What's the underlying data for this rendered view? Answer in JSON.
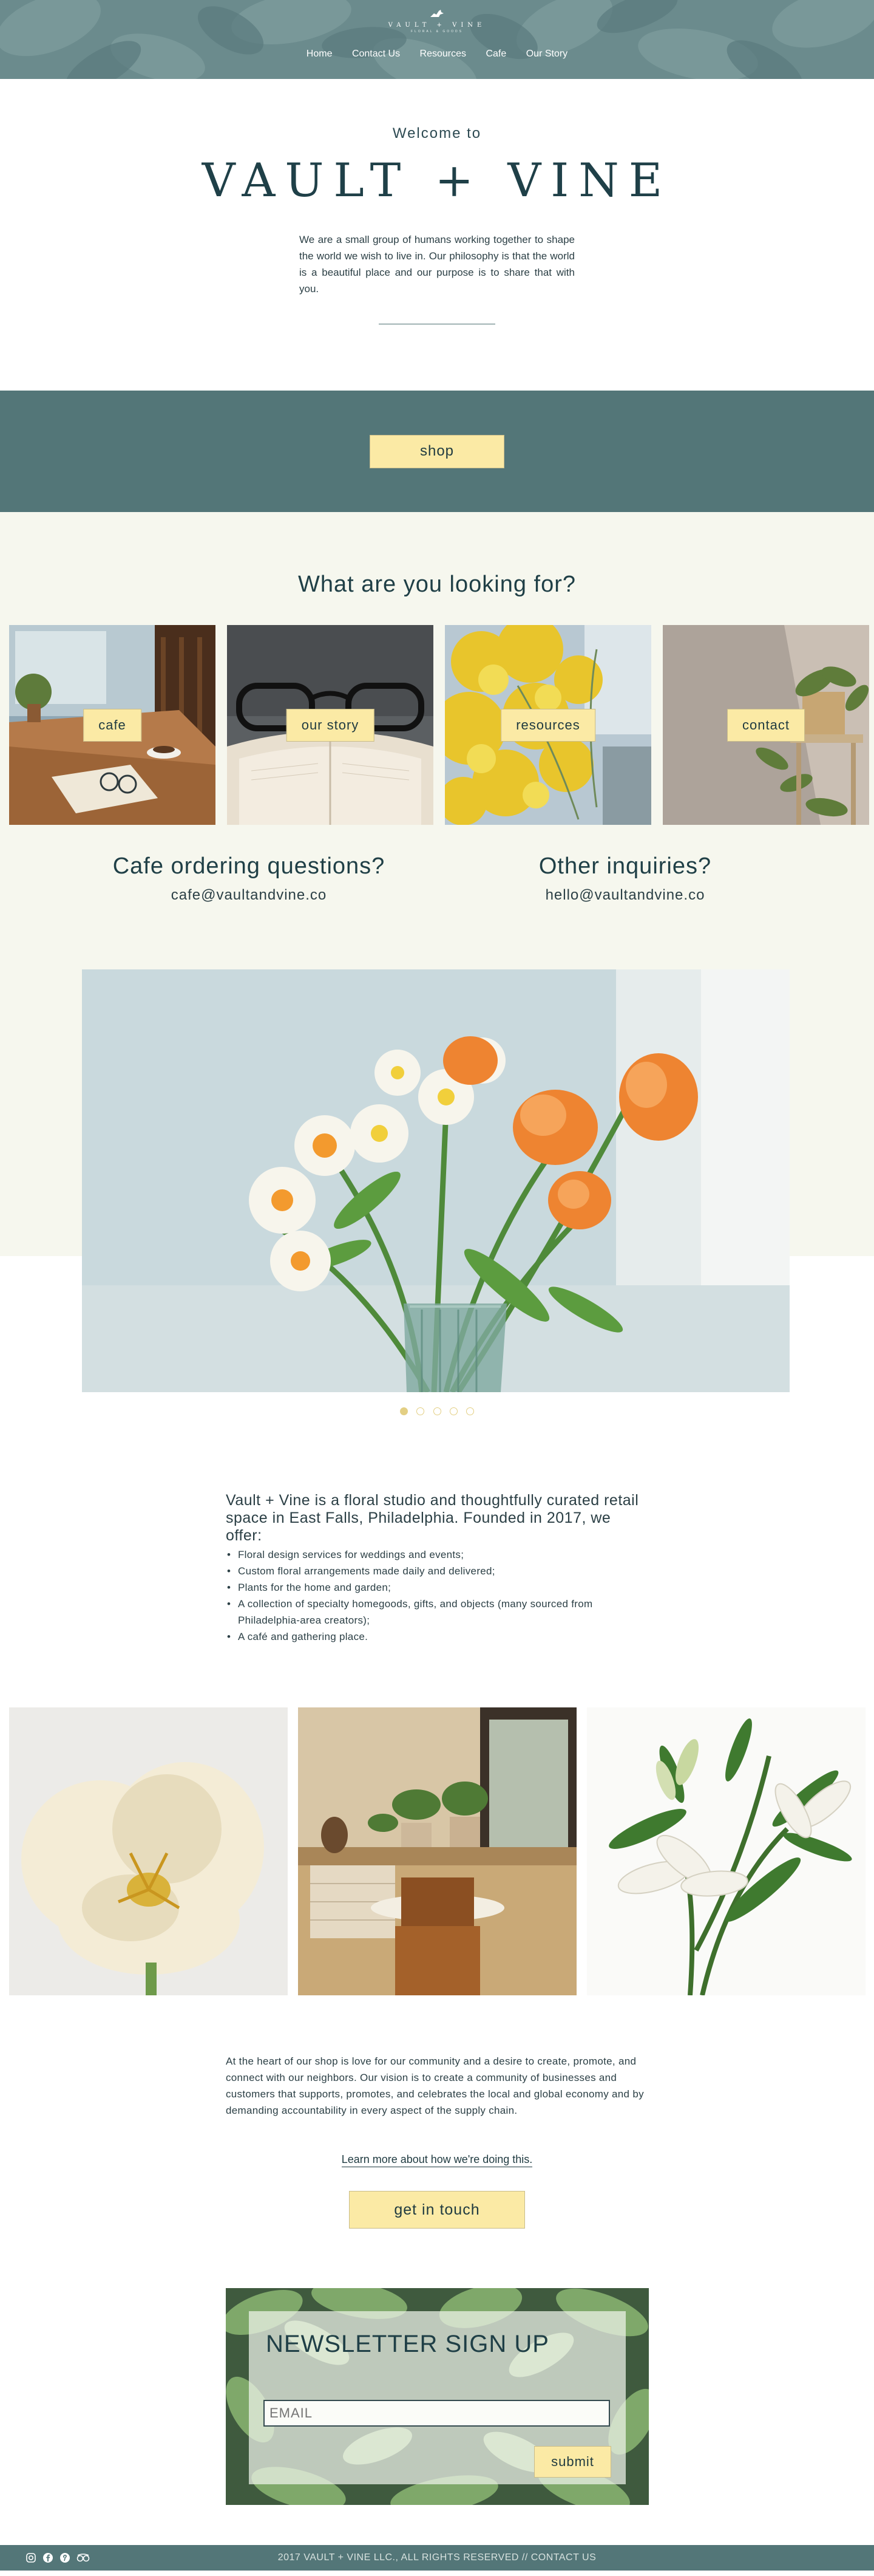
{
  "header": {
    "logo_text": "VAULT + VINE",
    "logo_sub": "FLORAL & GOODS",
    "nav": [
      "Home",
      "Contact Us",
      "Resources",
      "Cafe",
      "Our Story"
    ]
  },
  "welcome": {
    "pre": "Welcome to",
    "title": "VAULT + VINE",
    "intro": "We are a small group of humans working together to shape the world we wish to live in. Our philosophy is that the world is a beautiful place and our purpose is to share that with you."
  },
  "shop": {
    "label": "shop"
  },
  "looking": {
    "heading": "What are you looking for?",
    "tiles": [
      {
        "label": "cafe",
        "icon": "cafe-photo"
      },
      {
        "label": "our story",
        "icon": "book-glasses-photo"
      },
      {
        "label": "resources",
        "icon": "mimosa-photo"
      },
      {
        "label": "contact",
        "icon": "plant-shelf-photo"
      }
    ]
  },
  "inquiries": {
    "cafe_title": "Cafe ordering questions?",
    "cafe_email": "cafe@vaultandvine.co",
    "other_title": "Other inquiries?",
    "other_email": "hello@vaultandvine.co"
  },
  "slideshow": {
    "slide_count": 5,
    "active_index": 0
  },
  "about": {
    "lead": "Vault + Vine is a floral studio and thoughtfully curated retail space in East Falls, Philadelphia. Founded in 2017, we offer:",
    "offers": [
      "Floral design services for weddings and events;",
      "Custom floral arrangements made daily and delivered;",
      "Plants for the home and garden;",
      "A collection of specialty homegoods, gifts, and objects (many sourced from Philadelphia-area creators);",
      "A café and gathering place."
    ]
  },
  "community": {
    "text": "At the heart of our shop is love for our community and a desire to create, promote, and connect with our neighbors. Our vision is to create a community of businesses and customers that supports, promotes, and celebrates the local and global economy and by demanding accountability in every aspect of the supply chain.",
    "learn_more": "Learn more about how we're doing this.",
    "cta": "get in touch"
  },
  "newsletter": {
    "title": "NEWSLETTER SIGN UP",
    "email_placeholder": "EMAIL",
    "submit": "submit"
  },
  "footer": {
    "copyright": "2017 VAULT + VINE LLC., ALL RIGHTS RESERVED // CONTACT US",
    "social": [
      "instagram-icon",
      "facebook-icon",
      "pinterest-icon",
      "tripadvisor-icon"
    ]
  }
}
